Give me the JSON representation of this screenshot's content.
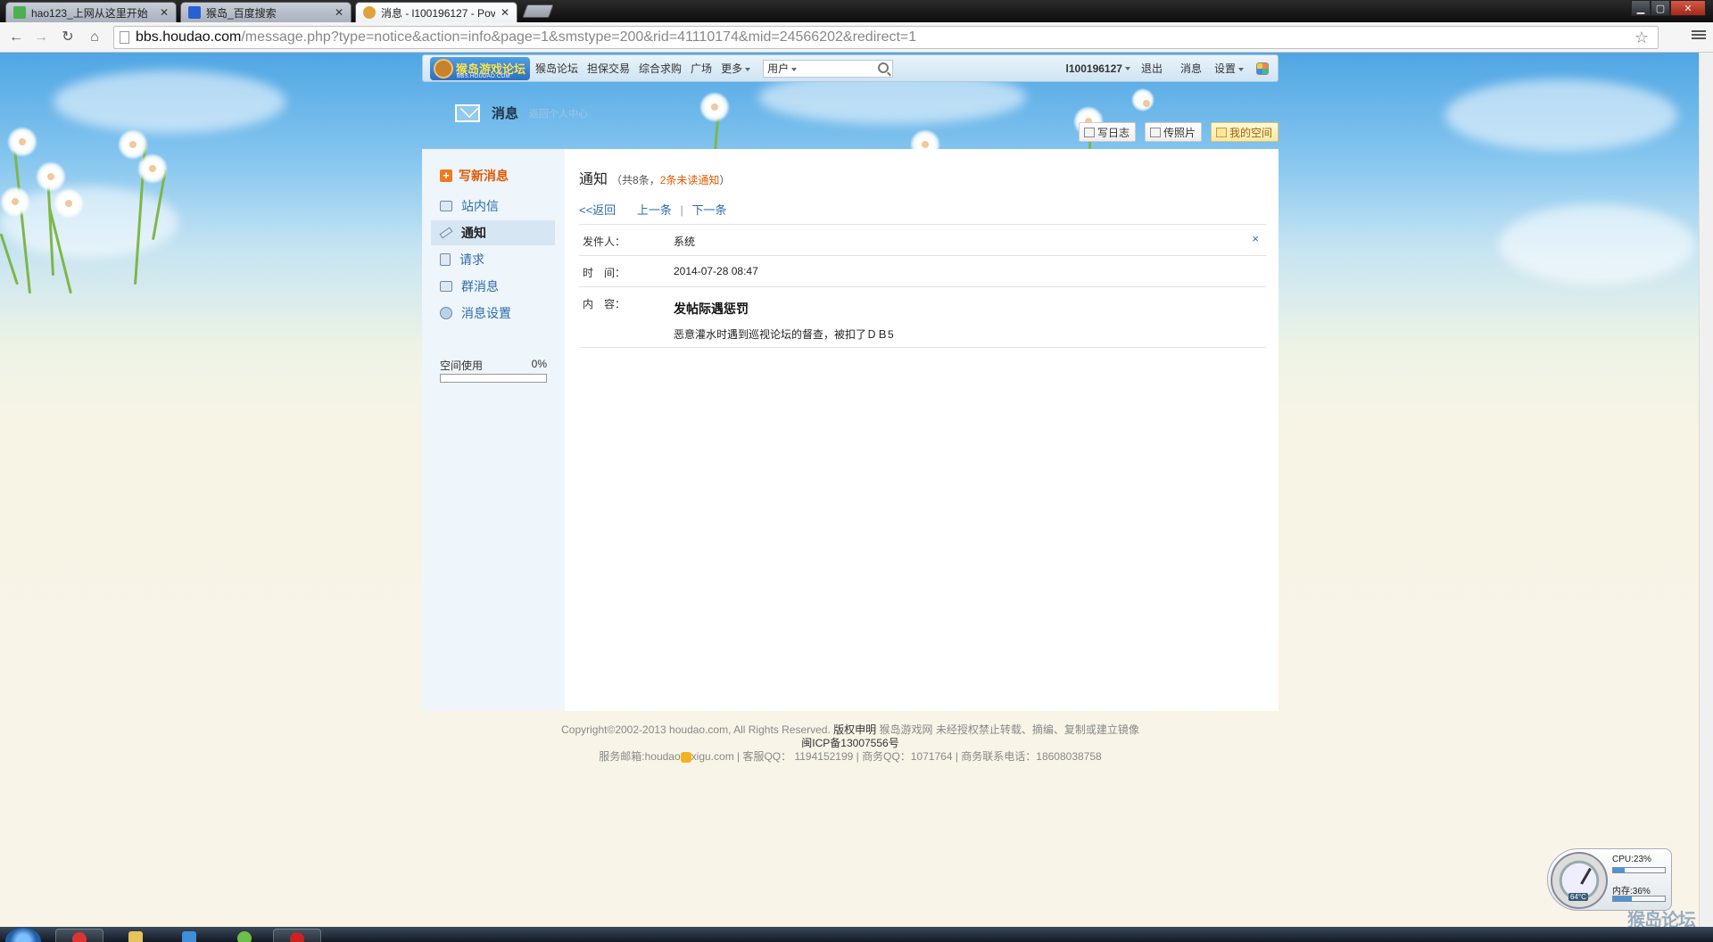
{
  "browser": {
    "tabs": [
      {
        "title": "hao123_上网从这里开始",
        "active": false,
        "favicon_color": "#4caf50"
      },
      {
        "title": "猴岛_百度搜索",
        "active": false,
        "favicon_color": "#2a5fd4"
      },
      {
        "title": "消息 - l100196127 - Pov",
        "active": true,
        "favicon_color": "#e0a23a"
      }
    ],
    "url": {
      "host": "bbs.houdao.com",
      "path": "/message.php?type=notice&action=info&page=1&smstype=200&rid=41110174&mid=24566202&redirect=1"
    }
  },
  "topnav": {
    "logo_text": "猴岛游戏论坛",
    "logo_sub": "BBS.HOUDAO.COM",
    "links": [
      "猴岛论坛",
      "担保交易",
      "综合求购",
      "广场",
      "更多"
    ],
    "search_select": "用户",
    "username": "l100196127",
    "logout": "退出",
    "messages": "消息",
    "settings": "设置"
  },
  "heading": {
    "title": "消息",
    "back_link": "返回个人中心"
  },
  "quick_buttons": [
    "写日志",
    "传照片",
    "我的空间"
  ],
  "sidebar": {
    "compose": "写新消息",
    "items": [
      {
        "label": "站内信",
        "active": false,
        "icon": "envelope-icon"
      },
      {
        "label": "通知",
        "active": true,
        "icon": "pencil-icon"
      },
      {
        "label": "请求",
        "active": false,
        "icon": "document-icon"
      },
      {
        "label": "群消息",
        "active": false,
        "icon": "group-icon"
      },
      {
        "label": "消息设置",
        "active": false,
        "icon": "settings-icon"
      }
    ],
    "usage_label": "空间使用",
    "usage_value": "0%",
    "usage_fraction": 0
  },
  "notice": {
    "title": "通知",
    "count_prefix": "（共8条，",
    "unread": "2条未读通知",
    "count_suffix": "）",
    "back": "<<返回",
    "prev": "上一条",
    "separator": "|",
    "next": "下一条",
    "sender_label": "发件人：",
    "sender": "系统",
    "delete": "×",
    "time_label": "时　间：",
    "time": "2014-07-28 08:47",
    "content_label": "内　容：",
    "content_title": "发帖际遇惩罚",
    "content_body": "恶意灌水时遇到巡视论坛的督查，被扣了ＤＢ5"
  },
  "footer": {
    "line1_a": "Copyright©2002-2013 houdao.com, All Rights Reserved.",
    "line1_b": "版权申明",
    "line1_c": "猴岛游戏网 未经授权禁止转载、摘编、复制或建立镜像",
    "line2": "闽ICP备13007556号",
    "line3_a": "服务邮箱:houdao",
    "line3_b": "xigu.com | 客服QQ： 1194152199 | 商务QQ：1071764 | 商务联系电话：18608038758"
  },
  "gadget": {
    "cpu": "CPU:23%",
    "cpu_fraction": 0.23,
    "mem": "内存:36%",
    "mem_fraction": 0.36,
    "temp": "64°C"
  },
  "watermark": "猴岛论坛"
}
